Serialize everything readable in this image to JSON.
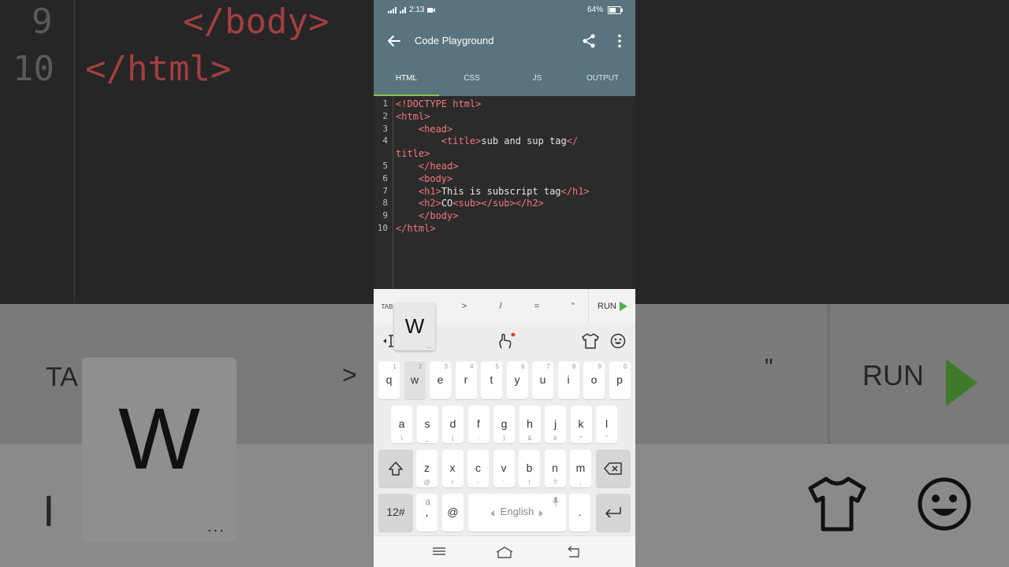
{
  "status_bar": {
    "time": "2:13",
    "battery": "64%",
    "battery_level": 0.64
  },
  "app": {
    "title": "Code Playground"
  },
  "tabs": [
    {
      "label": "HTML",
      "active": true
    },
    {
      "label": "CSS",
      "active": false
    },
    {
      "label": "JS",
      "active": false
    },
    {
      "label": "OUTPUT",
      "active": false
    }
  ],
  "editor": {
    "lines": [
      {
        "num": "1",
        "parts": [
          {
            "t": "tag",
            "s": "<!DOCTYPE html>"
          }
        ]
      },
      {
        "num": "2",
        "parts": [
          {
            "t": "tag",
            "s": "<html>"
          }
        ]
      },
      {
        "num": "3",
        "parts": [
          {
            "t": "txt",
            "s": "    "
          },
          {
            "t": "tag",
            "s": "<head>"
          }
        ]
      },
      {
        "num": "4",
        "parts": [
          {
            "t": "txt",
            "s": "        "
          },
          {
            "t": "tag",
            "s": "<title>"
          },
          {
            "t": "txt",
            "s": "sub and sup tag"
          },
          {
            "t": "tag",
            "s": "</"
          }
        ]
      },
      {
        "num": "",
        "parts": [
          {
            "t": "tag",
            "s": "title>"
          }
        ]
      },
      {
        "num": "5",
        "parts": [
          {
            "t": "txt",
            "s": "    "
          },
          {
            "t": "tag",
            "s": "</head>"
          }
        ]
      },
      {
        "num": "6",
        "parts": [
          {
            "t": "txt",
            "s": "    "
          },
          {
            "t": "tag",
            "s": "<body>"
          }
        ]
      },
      {
        "num": "7",
        "parts": [
          {
            "t": "txt",
            "s": "    "
          },
          {
            "t": "tag",
            "s": "<h1>"
          },
          {
            "t": "txt",
            "s": "This is subscript tag"
          },
          {
            "t": "tag",
            "s": "</h1>"
          }
        ]
      },
      {
        "num": "8",
        "parts": [
          {
            "t": "txt",
            "s": "    "
          },
          {
            "t": "tag",
            "s": "<h2>"
          },
          {
            "t": "txt",
            "s": "CO"
          },
          {
            "t": "tag",
            "s": "<sub></sub></h2>"
          }
        ]
      },
      {
        "num": "9",
        "parts": [
          {
            "t": "txt",
            "s": "    "
          },
          {
            "t": "tag",
            "s": "</body>"
          }
        ]
      },
      {
        "num": "10",
        "parts": [
          {
            "t": "tag",
            "s": "</html>"
          }
        ]
      }
    ]
  },
  "symbol_bar": {
    "tab_label": "TAB",
    "symbols": [
      ">",
      "/",
      "=",
      "\""
    ],
    "run_label": "RUN"
  },
  "keyboard": {
    "key_preview": {
      "letter": "W",
      "more": "..."
    },
    "row1": [
      {
        "k": "q",
        "s": "1"
      },
      {
        "k": "w",
        "s": "2"
      },
      {
        "k": "e",
        "s": "3"
      },
      {
        "k": "r",
        "s": "4"
      },
      {
        "k": "t",
        "s": "5"
      },
      {
        "k": "y",
        "s": "6"
      },
      {
        "k": "u",
        "s": "7"
      },
      {
        "k": "i",
        "s": "8"
      },
      {
        "k": "o",
        "s": "9"
      },
      {
        "k": "p",
        "s": "0"
      }
    ],
    "row2": [
      {
        "k": "a",
        "s": "\\"
      },
      {
        "k": "s",
        "s": "_"
      },
      {
        "k": "d",
        "s": "("
      },
      {
        "k": "f",
        "s": ":"
      },
      {
        "k": "g",
        "s": ")"
      },
      {
        "k": "h",
        "s": "&"
      },
      {
        "k": "j",
        "s": "#"
      },
      {
        "k": "k",
        "s": "*"
      },
      {
        "k": "l",
        "s": "\""
      }
    ],
    "row3": [
      {
        "k": "z",
        "s": "@"
      },
      {
        "k": "x",
        "s": "/"
      },
      {
        "k": "c",
        "s": "-"
      },
      {
        "k": "v",
        "s": "'"
      },
      {
        "k": "b",
        "s": "!"
      },
      {
        "k": "n",
        "s": "?"
      },
      {
        "k": "m",
        "s": ";"
      }
    ],
    "numbers_key": "12#",
    "comma_key": ",",
    "comma_alt": "a",
    "at_key": "@",
    "space_label": "English",
    "period_key": "."
  },
  "background": {
    "line_nums": [
      "9",
      "10"
    ],
    "code": [
      "</body>",
      "</html>"
    ],
    "tab_text": "TA",
    "gt_symbol": ">",
    "quote_symbol": "\"",
    "run_label": "RUN",
    "popup_letter": "W",
    "popup_more": "...",
    "cursor_glyph": "I"
  },
  "colors": {
    "toolbar": "#59747e",
    "tab_indicator": "#8bc34a",
    "tag": "#f2777a",
    "run_play": "#4caf50"
  }
}
